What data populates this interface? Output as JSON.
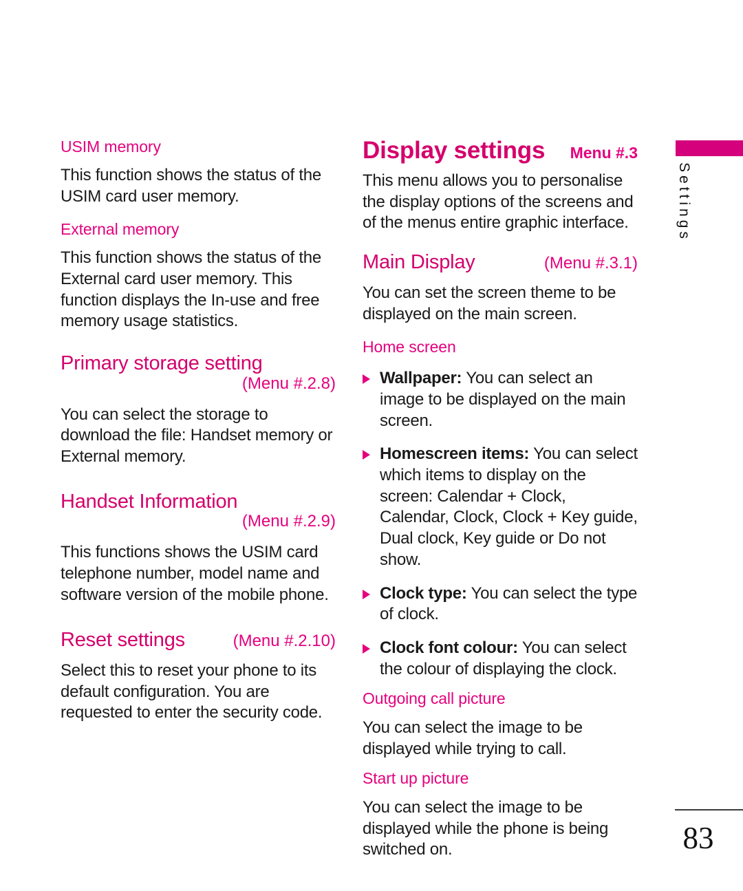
{
  "page": {
    "number": "83",
    "side_tab": "Settings"
  },
  "left_column": {
    "usim_memory": {
      "heading": "USIM memory",
      "body": "This function shows the status of the USIM card user memory."
    },
    "external_memory": {
      "heading": "External memory",
      "body": "This function shows the status of the External card user memory. This function displays the In-use and free memory usage statistics."
    },
    "primary_storage_setting": {
      "heading": "Primary storage setting",
      "menu": "(Menu #.2.8)",
      "body": "You can select the storage to download the file: Handset memory or External memory."
    },
    "handset_information": {
      "heading": "Handset Information",
      "menu": "(Menu #.2.9)",
      "body": "This functions shows the USIM card telephone number, model name and software version of the mobile phone."
    },
    "reset_settings": {
      "heading": "Reset settings",
      "menu": "(Menu #.2.10)",
      "body": "Select this to reset your phone to its default configuration. You are requested to enter the security code."
    }
  },
  "right_column": {
    "display_settings": {
      "heading": "Display settings",
      "menu": "Menu #.3",
      "body": "This menu allows you to personalise the display options of the screens and of the menus entire graphic interface."
    },
    "main_display": {
      "heading": "Main Display",
      "menu": "(Menu #.3.1)",
      "body": "You can set the screen theme to be displayed on the main screen."
    },
    "home_screen": {
      "heading": "Home screen",
      "bullets": [
        {
          "term": "Wallpaper:",
          "text": " You can select an image to be displayed on the main screen."
        },
        {
          "term": "Homescreen items:",
          "text": " You can select which items to display on the screen: Calendar + Clock, Calendar, Clock, Clock + Key guide, Dual clock, Key guide or Do not show."
        },
        {
          "term": "Clock type:",
          "text": " You can select the type of clock."
        },
        {
          "term": "Clock font colour:",
          "text": " You can select the colour of displaying the clock."
        }
      ]
    },
    "outgoing_call_picture": {
      "heading": "Outgoing call picture",
      "body": "You can select the image to be displayed while trying to call."
    },
    "start_up_picture": {
      "heading": "Start up picture",
      "body": "You can select the image to be displayed while the phone is being switched on."
    }
  },
  "colors": {
    "accent_pink": "#E4007E",
    "accent_magenta": "#D4006C",
    "tab_bar": "#D4007C"
  }
}
